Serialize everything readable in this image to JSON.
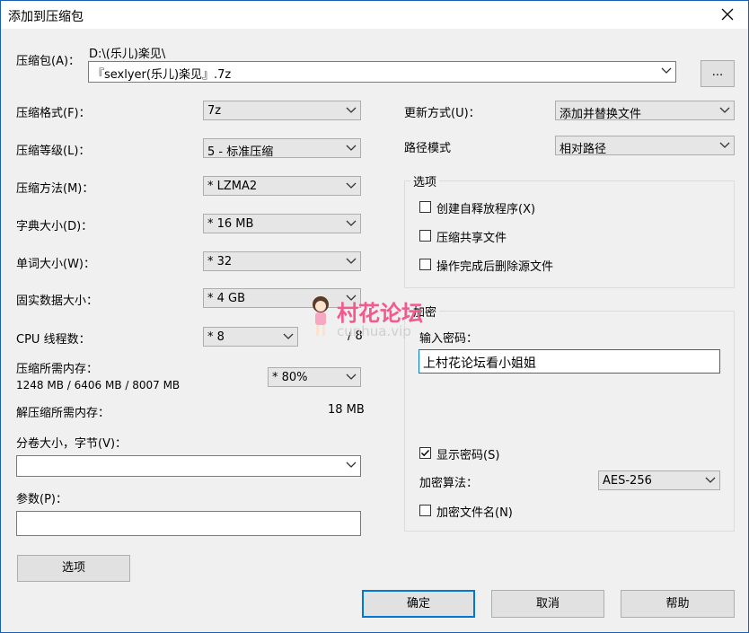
{
  "window": {
    "title": "添加到压缩包",
    "close_icon": "close-icon"
  },
  "archive": {
    "label": "压缩包(A)：",
    "path_hint": "D:\\(乐儿)楽见\\",
    "filename": "『sexlyer(乐儿)楽见』.7z",
    "browse_label": "..."
  },
  "left": {
    "format": {
      "label": "压缩格式(F)：",
      "value": "7z"
    },
    "level": {
      "label": "压缩等级(L)：",
      "value": "5 - 标准压缩"
    },
    "method": {
      "label": "压缩方法(M)：",
      "value": "* LZMA2"
    },
    "dict": {
      "label": "字典大小(D)：",
      "value": "* 16 MB"
    },
    "word": {
      "label": "单词大小(W)：",
      "value": "* 32"
    },
    "solid": {
      "label": "固实数据大小：",
      "value": "* 4 GB"
    },
    "threads": {
      "label": "CPU 线程数：",
      "value": "* 8",
      "max": "/ 8"
    },
    "mem_comp": {
      "label": "压缩所需内存：",
      "detail": "1248 MB / 6406 MB / 8007 MB",
      "value": "* 80%"
    },
    "mem_decomp": {
      "label": "解压缩所需内存：",
      "value": "18 MB"
    },
    "volume": {
      "label": "分卷大小，字节(V)：",
      "value": ""
    },
    "params": {
      "label": "参数(P)：",
      "value": ""
    },
    "options_button": "选项"
  },
  "right": {
    "update": {
      "label": "更新方式(U)：",
      "value": "添加并替换文件"
    },
    "pathmode": {
      "label": "路径模式",
      "value": "相对路径"
    },
    "options_group": {
      "title": "选项",
      "items": [
        {
          "label": "创建自释放程序(X)",
          "checked": false
        },
        {
          "label": "压缩共享文件",
          "checked": false
        },
        {
          "label": "操作完成后删除源文件",
          "checked": false
        }
      ]
    },
    "encryption": {
      "title": "加密",
      "password_label": "输入密码：",
      "password_value": "上村花论坛看小姐姐",
      "show_password": {
        "label": "显示密码(S)",
        "checked": true
      },
      "method_label": "加密算法：",
      "method_value": "AES-256",
      "encrypt_names": {
        "label": "加密文件名(N)",
        "checked": false
      }
    }
  },
  "watermark": {
    "text": "村花论坛",
    "sub": "cunhua.vip"
  },
  "buttons": {
    "ok": "确定",
    "cancel": "取消",
    "help": "帮助"
  }
}
